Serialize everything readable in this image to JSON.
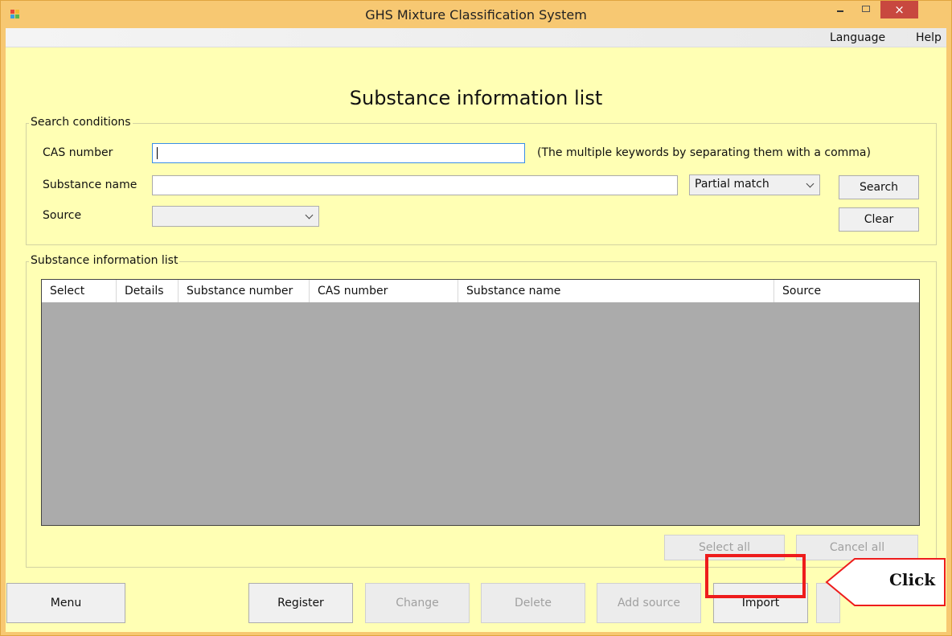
{
  "window": {
    "title": "GHS Mixture Classification System",
    "close_glyph": "×"
  },
  "menu": {
    "language": "Language",
    "help": "Help"
  },
  "page_title": "Substance information list",
  "search": {
    "legend": "Search conditions",
    "cas_label": "CAS number",
    "cas_value": "",
    "cas_hint": "(The multiple keywords by separating them with a comma)",
    "name_label": "Substance name",
    "name_value": "",
    "match_mode": "Partial match",
    "source_label": "Source",
    "source_value": "",
    "search_button": "Search",
    "clear_button": "Clear"
  },
  "list": {
    "legend": "Substance information list",
    "columns": [
      "Select",
      "Details",
      "Substance number",
      "CAS number",
      "Substance name",
      "Source"
    ],
    "rows": [],
    "select_all": "Select all",
    "cancel_all": "Cancel all"
  },
  "footer": {
    "menu": "Menu",
    "register": "Register",
    "change": "Change",
    "delete": "Delete",
    "add_source": "Add source",
    "import": "Import"
  },
  "annotation": {
    "callout_text": "Click",
    "highlight_color": "#ee1c1c"
  },
  "colors": {
    "title_bar": "#f7c872",
    "client_bg": "#ffffb4",
    "grid_bg": "#ababab",
    "close_button": "#c8483f"
  }
}
